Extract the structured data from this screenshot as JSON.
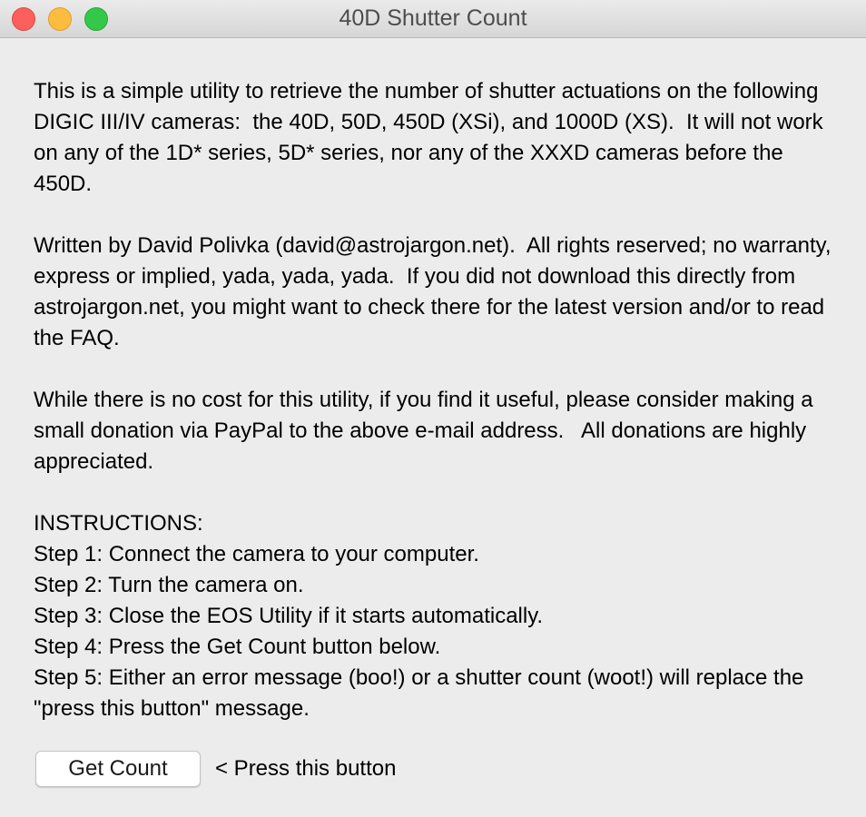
{
  "window": {
    "title": "40D Shutter Count"
  },
  "content": {
    "paragraphs": [
      "This is a simple utility to retrieve the number of shutter actuations on the following DIGIC III/IV cameras:  the 40D, 50D, 450D (XSi), and 1000D (XS).  It will not work on any of the 1D* series, 5D* series, nor any of the XXXD cameras before the 450D.",
      "Written by David Polivka (david@astrojargon.net).  All rights reserved; no warranty, express or implied, yada, yada, yada.  If you did not download this directly from astrojargon.net, you might want to check there for the latest version and/or to read the FAQ.",
      "While there is no cost for this utility, if you find it useful, please consider making a small donation via PayPal to the above e-mail address.   All donations are highly appreciated."
    ],
    "instructions": {
      "heading": "INSTRUCTIONS:",
      "steps": [
        "Step 1: Connect the camera to your computer.",
        "Step 2: Turn the camera on.",
        "Step 3: Close the EOS Utility if it starts automatically.",
        "Step 4: Press the Get Count button below.",
        "Step 5: Either an error message (boo!) or a shutter count (woot!) will replace the \"press this button\" message."
      ]
    }
  },
  "actions": {
    "get_count_label": "Get Count",
    "status_message": "< Press this button"
  }
}
